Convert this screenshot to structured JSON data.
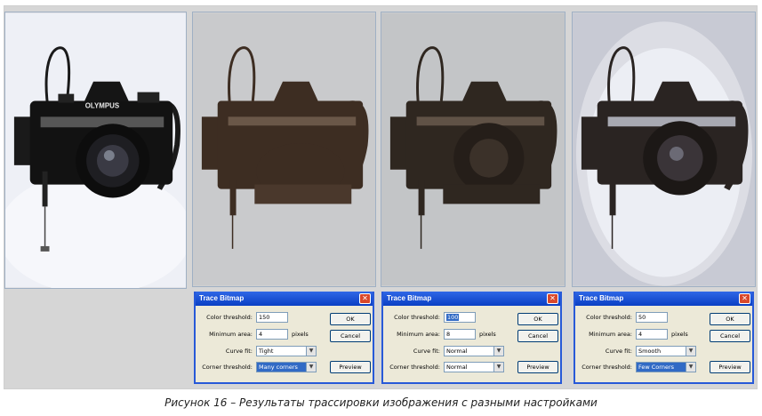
{
  "panels": [
    {
      "id": "original",
      "background": "#eef0f6",
      "body_color": "#121212"
    },
    {
      "id": "trace-1",
      "background": "#c9cacc",
      "body_color": "#3d2d22"
    },
    {
      "id": "trace-2",
      "background": "#c3c5c7",
      "body_color": "#2f2720"
    },
    {
      "id": "trace-3",
      "background": "#dcdde4",
      "body_color": "#2a2422"
    }
  ],
  "camera_brand": "OLYMPUS",
  "dialogs": [
    {
      "title": "Trace Bitmap",
      "color_threshold_label": "Color threshold:",
      "color_threshold": "150",
      "minimum_area_label": "Minimum area:",
      "minimum_area": "4",
      "pixels_label": "pixels",
      "curve_fit_label": "Curve fit:",
      "curve_fit": "Tight",
      "corner_threshold_label": "Corner threshold:",
      "corner_threshold": "Many corners",
      "ok": "OK",
      "cancel": "Cancel",
      "preview": "Preview"
    },
    {
      "title": "Trace Bitmap",
      "color_threshold_label": "Color threshold:",
      "color_threshold": "100",
      "minimum_area_label": "Minimum area:",
      "minimum_area": "8",
      "pixels_label": "pixels",
      "curve_fit_label": "Curve fit:",
      "curve_fit": "Normal",
      "corner_threshold_label": "Corner threshold:",
      "corner_threshold": "Normal",
      "ok": "OK",
      "cancel": "Cancel",
      "preview": "Preview"
    },
    {
      "title": "Trace Bitmap",
      "color_threshold_label": "Color threshold:",
      "color_threshold": "50",
      "minimum_area_label": "Minimum area:",
      "minimum_area": "4",
      "pixels_label": "pixels",
      "curve_fit_label": "Curve fit:",
      "curve_fit": "Smooth",
      "corner_threshold_label": "Corner threshold:",
      "corner_threshold": "Few Corners",
      "ok": "OK",
      "cancel": "Cancel",
      "preview": "Preview"
    }
  ],
  "caption": "Рисунок 16 – Результаты трассировки изображения с разными настройками"
}
